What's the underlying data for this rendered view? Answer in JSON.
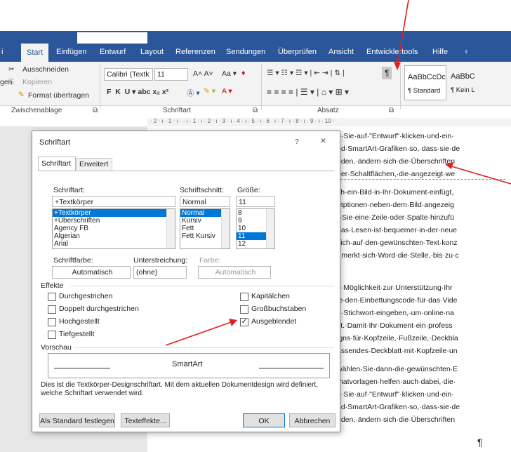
{
  "ribbon": {
    "tabs": [
      "Start",
      "Einfügen",
      "Entwurf",
      "Layout",
      "Referenzen",
      "Sendungen",
      "Überprüfen",
      "Ansicht",
      "Entwicklertools",
      "Hilfe"
    ],
    "clipboard": {
      "cut": "Ausschneiden",
      "copy": "Kopieren",
      "paste_partial": "gen",
      "format_painter": "Format übertragen",
      "group": "Zwischenablage"
    },
    "font": {
      "name": "Calibri (Textk",
      "size": "11",
      "group": "Schriftart"
    },
    "paragraph": {
      "group": "Absatz"
    },
    "styles": {
      "preview1": "AaBbCcDc",
      "preview2": "AaBbC",
      "style1": "¶ Standard",
      "style2": "¶ Kein L"
    }
  },
  "ruler": "· 2 · ı · 1 · ı ·  · ı · 1 · ı · 2 · ı · 3 · ı · 4 · ı · 5 · ı · 6 · ı · 7 · ı · 8 · ı · 9 · ı · 10 ·",
  "doc_lines": [
    "n·Sie·auf·\"Entwurf\"·klicken·und·ein·",
    "nd·SmartArt-Grafiken·so,·dass·sie·de",
    "nden,·ändern·sich·die·Überschriften",
    "uer·Schaltflächen,·die·angezeigt·we",
    "ch·ein·Bild·in·Ihr·Dokument·einfügt,",
    "otptionen·neben·dem·Bild·angezeig",
    "r·Sie·eine·Zeile·oder·Spalte·hinzufü",
    "das·Lesen·ist·bequemer·in·der·neue",
    "sich·auf·den·gewünschten·Text·konz",
    ",·merkt·sich·Word·die·Stelle,·bis·zu·c",
    "e·Möglichkeit·zur·Unterstützung·Ihr",
    "ie·den·Einbettungscode·für·das·Vide",
    "n·Stichwort·eingeben,·um·online·na",
    "st.·Damit·Ihr·Dokument·ein·profess",
    "igns·für·Kopfzeile,·Fußzeile,·Deckbla",
    "assendes·Deckblatt·mit·Kopfzeile·un",
    "wählen·Sie·dann·die·gewünschten·E",
    "matvorlagen·helfen·auch·dabei,·die·",
    "n·Sie·auf·\"Entwurf\"·klicken·und·ein·",
    "nd·SmartArt-Grafiken·so,·dass·sie·de",
    "nden,·ändern·sich·die·Überschriften"
  ],
  "pilcrow": "¶",
  "dialog": {
    "title": "Schriftart",
    "help": "?",
    "close": "✕",
    "tab_font": "Schriftart",
    "tab_advanced": "Erweitert",
    "font_label": "Schriftart:",
    "font_value": "+Textkörper",
    "font_list": [
      "+Textkörper",
      "+Überschriften",
      "Agency FB",
      "Algerian",
      "Arial"
    ],
    "style_label": "Schriftschnitt:",
    "style_value": "Normal",
    "style_list": [
      "Normal",
      "Kursiv",
      "Fett",
      "Fett Kursiv"
    ],
    "size_label": "Größe:",
    "size_value": "11",
    "size_list": [
      "8",
      "9",
      "10",
      "11",
      "12"
    ],
    "color_label": "Schriftfarbe:",
    "color_value": "Automatisch",
    "underline_label": "Unterstreichung:",
    "underline_value": "(ohne)",
    "ucolor_label": "Farbe:",
    "ucolor_value": "Automatisch",
    "effects_label": "Effekte",
    "effects_left": [
      "Durchgestrichen",
      "Doppelt durchgestrichen",
      "Hochgestellt",
      "Tiefgestellt"
    ],
    "effects_right": [
      "Kapitälchen",
      "Großbuchstaben",
      "Ausgeblendet"
    ],
    "preview_label": "Vorschau",
    "preview_text": "SmartArt",
    "description": "Dies ist die Textkörper-Designschriftart. Mit dem aktuellen Dokumentdesign wird definiert,",
    "description2": "welche Schriftart verwendet wird.",
    "btn_default": "Als Standard festlegen",
    "btn_effects": "Texteffekte...",
    "btn_ok": "OK",
    "btn_cancel": "Abbrechen"
  },
  "colors": {
    "accent": "#2b579a",
    "arrow": "#e02020",
    "selection": "#0078d7"
  }
}
